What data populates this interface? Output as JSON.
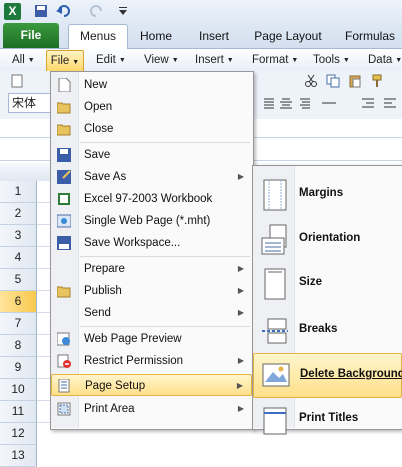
{
  "app_icon": "X",
  "ribbon_tabs": {
    "file": "File",
    "menus": "Menus",
    "home": "Home",
    "insert": "Insert",
    "page_layout": "Page Layout",
    "formulas": "Formulas"
  },
  "menubar": {
    "all": "All",
    "file": "File",
    "edit": "Edit",
    "view": "View",
    "insert": "Insert",
    "format": "Format",
    "tools": "Tools",
    "data": "Data"
  },
  "font_name": "宋体",
  "row_numbers": [
    "1",
    "2",
    "3",
    "4",
    "5",
    "6",
    "7",
    "8",
    "9",
    "10",
    "11",
    "12",
    "13"
  ],
  "file_menu": {
    "new": "New",
    "open": "Open",
    "close": "Close",
    "save": "Save",
    "save_as": "Save As",
    "excel_97": "Excel 97-2003 Workbook",
    "single_web_page": "Single Web Page (*.mht)",
    "save_workspace": "Save Workspace...",
    "prepare": "Prepare",
    "publish": "Publish",
    "send": "Send",
    "web_page_preview": "Web Page Preview",
    "restrict_permission": "Restrict Permission",
    "page_setup": "Page Setup",
    "print_area": "Print Area"
  },
  "page_setup_submenu": {
    "margins": "Margins",
    "orientation": "Orientation",
    "size": "Size",
    "breaks": "Breaks",
    "delete_background": "Delete Background",
    "print_titles": "Print Titles"
  },
  "colors": {
    "file_tab": "#1d6e24",
    "highlight": "#ffe08a",
    "selected_row": "#f9c94f"
  }
}
